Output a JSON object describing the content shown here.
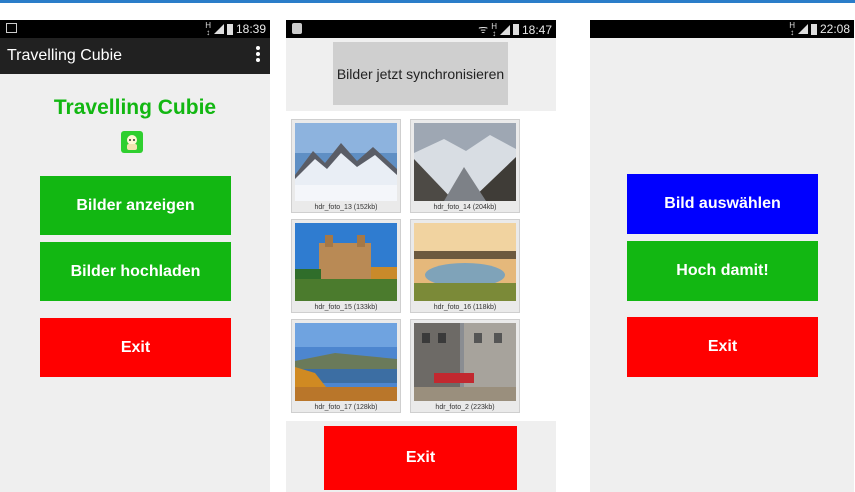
{
  "phone1": {
    "time": "18:39",
    "app_title": "Travelling Cubie",
    "heading": "Travelling Cubie",
    "buttons": {
      "show": "Bilder anzeigen",
      "upload": "Bilder hochladen",
      "exit": "Exit"
    },
    "colors": {
      "heading": "#12b712",
      "green": "#12b712",
      "red": "#ff0000"
    }
  },
  "phone2": {
    "time": "18:47",
    "sync_button": "Bilder jetzt synchronisieren",
    "images": [
      {
        "caption": "hdr_foto_13 (152kb)",
        "icon": "mountain-snow-photo"
      },
      {
        "caption": "hdr_foto_14 (204kb)",
        "icon": "mountain-valley-photo"
      },
      {
        "caption": "hdr_foto_15 (133kb)",
        "icon": "castle-photo"
      },
      {
        "caption": "hdr_foto_16 (118kb)",
        "icon": "lake-sunset-photo"
      },
      {
        "caption": "hdr_foto_17 (128kb)",
        "icon": "river-autumn-photo"
      },
      {
        "caption": "hdr_foto_2 (223kb)",
        "icon": "street-building-photo"
      }
    ],
    "exit": "Exit"
  },
  "phone3": {
    "time": "22:08",
    "buttons": {
      "select": "Bild auswählen",
      "upload": "Hoch damit!",
      "exit": "Exit"
    },
    "colors": {
      "blue": "#0000ff",
      "green": "#12b712",
      "red": "#ff0000"
    }
  }
}
